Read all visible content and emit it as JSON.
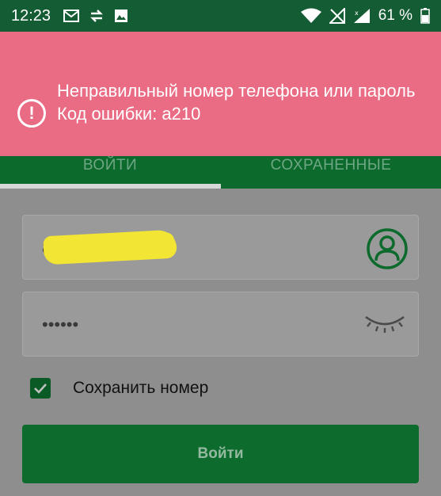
{
  "status_bar": {
    "time": "12:23",
    "battery": "61 %",
    "icons_left": [
      "mail-icon",
      "sync-icon",
      "image-icon"
    ],
    "icons_right": [
      "wifi-icon",
      "no-sim-icon",
      "signal-icon",
      "battery-icon"
    ]
  },
  "error_banner": {
    "line1": "Неправильный номер телефона или пароль",
    "line2": "Код ошибки: a210",
    "icon": "alert-circle-icon",
    "color": "#ea6b84"
  },
  "tabs": [
    {
      "label": "ВОЙТИ",
      "active": true
    },
    {
      "label": "СОХРАНЕННЫЕ",
      "active": false
    }
  ],
  "form": {
    "phone_value": "8",
    "password_value": "••••••",
    "remember_label": "Сохранить номер",
    "remember_checked": true,
    "submit_label": "Войти"
  },
  "colors": {
    "brand_green": "#0b6a2c",
    "status_bar": "#145c33",
    "overlay": "#8e8e8e"
  }
}
